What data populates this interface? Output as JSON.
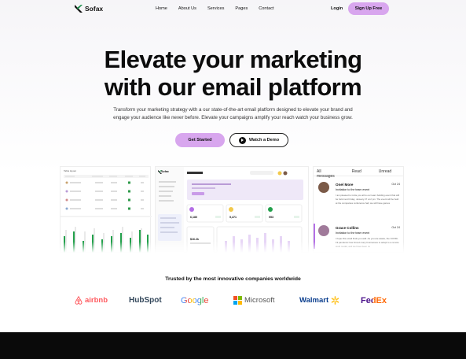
{
  "nav": {
    "brand": "Sofax",
    "links": [
      "Home",
      "About Us",
      "Services",
      "Pages",
      "Contact"
    ],
    "login": "Login",
    "signup": "Sign Up Free"
  },
  "hero": {
    "headline_line1": "Elevate your marketing",
    "headline_line2": "with our email platform",
    "subtext_line1": "Transform your marketing strategy with a our state-of-the-art email platform designed to elevate your brand and",
    "subtext_line2": "engage your audience like never before. Elevate your campaigns amplify your reach watch your business grow.",
    "cta_primary": "Get Started",
    "cta_secondary": "Watch a Demo"
  },
  "preview": {
    "left_title": "Table layout",
    "mid_brand": "Sofax",
    "mid_stats": [
      "6,180",
      "5,471",
      "953"
    ],
    "mid_value": "$16.2k",
    "inbox_tabs": [
      "All messages",
      "Read",
      "Unread"
    ],
    "messages": [
      {
        "name": "Onel  More",
        "subject": "Invitation to the team event",
        "date": "Oct 24",
        "body": "I am pleased to invite you all to our team building event that will be held next Friday, January 27 at 2 pm. The event will be held at the companies conference hall, we will have games"
      },
      {
        "name": "Grace Collins",
        "subject": "Invitation to the team event",
        "date": "Oct 24",
        "body": "I hope this email finds you well. As you are aware, the COVID-19 pandemic has forced many businesses to adapt to a remote work model, and we have been no"
      }
    ]
  },
  "trusted": {
    "title": "Trusted by the most innovative companies worldwide",
    "logos": [
      "airbnb",
      "HubSpot",
      "Google",
      "Microsoft",
      "Walmart",
      "FedEx"
    ]
  },
  "colors": {
    "accent": "#d8a6ee",
    "dark": "#0a0a0a"
  }
}
